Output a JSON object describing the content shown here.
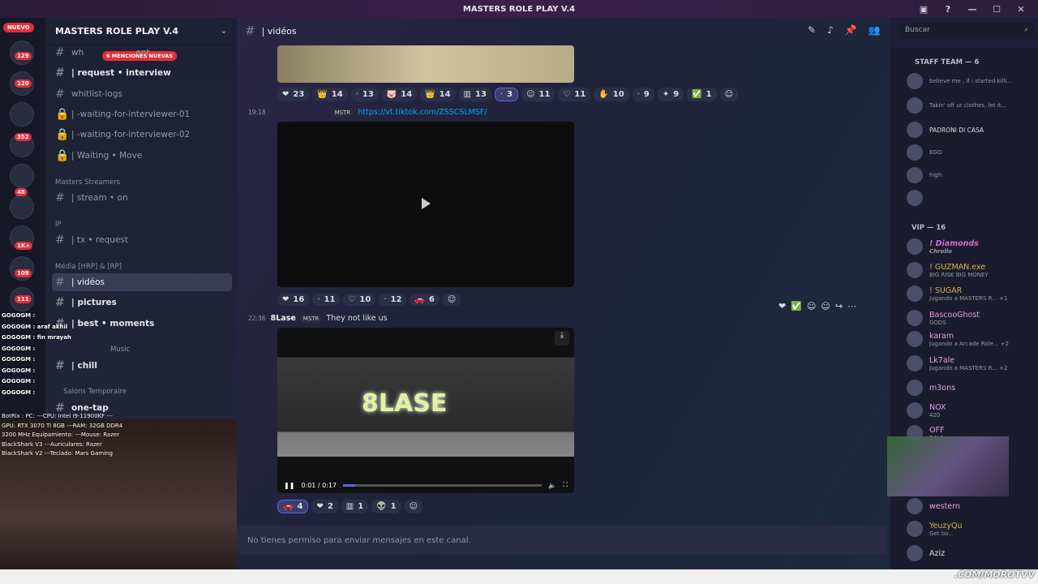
{
  "window": {
    "title": "MASTERS ROLE PLAY V.4"
  },
  "rail": {
    "nuevo": "NUEVO",
    "badges": [
      "129",
      "120",
      "352",
      "48",
      "1K+",
      "109",
      "111"
    ]
  },
  "server": {
    "name": "MASTERS ROLE PLAY V.4",
    "mentions": "6 MENCIONES NUEVAS"
  },
  "channels": [
    {
      "label": "wh",
      "suffix": "ent"
    },
    {
      "label": "| request • interview"
    },
    {
      "label": "whitlist-logs"
    },
    {
      "label": "| -waiting-for-interviewer-01"
    },
    {
      "label": "| -waiting-for-interviewer-02"
    },
    {
      "label": "| Waiting • Move"
    },
    {
      "label": "| stream • on"
    },
    {
      "label": "| tx • request"
    },
    {
      "label": "| vidéos"
    },
    {
      "label": "| pictures"
    },
    {
      "label": "| best • moments"
    },
    {
      "label": "| chill"
    },
    {
      "label": "one-tap"
    }
  ],
  "categories": [
    "Masters Streamers",
    "IP",
    "Média [HRP] & [RP]",
    "Music",
    "Salons Temporaire"
  ],
  "header": {
    "channel": "| vidéos",
    "search": "Buscar"
  },
  "reactions1": [
    "23",
    "14",
    "13",
    "14",
    "14",
    "13",
    "3",
    "11",
    "11",
    "10",
    "9",
    "9",
    "1"
  ],
  "msg1": {
    "time": "19:18",
    "tag": "MSTR",
    "link": "https://vt.tiktok.com/ZSSCSLMSF/"
  },
  "reactions2": [
    "16",
    "11",
    "10",
    "12",
    "6"
  ],
  "msg2": {
    "time": "22:36",
    "author": "8Lase",
    "tag": "MSTR",
    "text": "They not like us"
  },
  "video": {
    "title": "8LASE",
    "time": "0:01 / 0:17",
    "progress": 0.06
  },
  "reactions3": [
    "4",
    "2",
    "1",
    "1"
  ],
  "input": {
    "placeholder": "No tienes permiso para enviar mensajes en este canal."
  },
  "members": {
    "staff_cat": "STAFF TEAM — 6",
    "staff": [
      {
        "name": "",
        "sub": "believe me , if i started killi..."
      },
      {
        "name": "",
        "sub": "Takin' off ur clothes, let it..."
      },
      {
        "name": "PADRONI DI CASA",
        "sub": ""
      },
      {
        "name": "",
        "sub": "EGO"
      },
      {
        "name": "",
        "sub": "high"
      },
      {
        "name": "",
        "sub": ""
      }
    ],
    "vip_cat": "VIP — 16",
    "vip": [
      {
        "name": "! Diamonds",
        "sub": "Chrollo"
      },
      {
        "name": "! GUZMAN.exe",
        "sub": "BIG RISK BIG MONEY"
      },
      {
        "name": "! SUGAR",
        "sub": "Jugando a MASTERS R... +1"
      },
      {
        "name": "BascooGhost",
        "sub": "GODS"
      },
      {
        "name": "karam",
        "sub": "Jugando a Arcade Role... +2"
      },
      {
        "name": "Lk7ale",
        "sub": "Jugando a MASTERS R... +2"
      },
      {
        "name": "m3ons",
        "sub": ""
      },
      {
        "name": "NOX",
        "sub": "420"
      },
      {
        "name": "OFF",
        "sub": "B4LS"
      },
      {
        "name": "western",
        "sub": ""
      },
      {
        "name": "YeuzyQu",
        "sub": "Get bo..."
      },
      {
        "name": "Aziz",
        "sub": ""
      }
    ]
  },
  "stream_overlay": {
    "chat": [
      "GOGOGM :",
      "GOGOGM : araf akhil",
      "GOGOGM : fin mrayah",
      "GOGOGM :",
      "GOGOGM :",
      "GOGOGM :",
      "GOGOGM :",
      "GOGOGM :"
    ],
    "specs": "BotRix : PC: ---CPU: Intel i9-11900KF ---GPU: RTX 3070 Ti 8GB ---RAM: 32GB DDR4 3200 MHz Equipamiento: ---Mouse: Razer BlackShark V3 ---Auriculares: Razer BlackShark V2 ---Teclado: Mars Gaming",
    "watermark": ".COM/MOROTVV"
  }
}
